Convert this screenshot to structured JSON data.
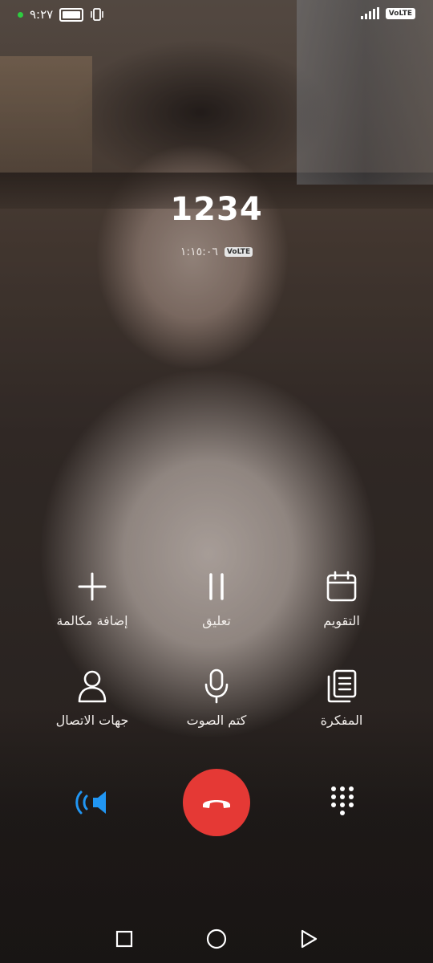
{
  "status_bar": {
    "time": "٩:٢٧",
    "network_badge": "VoLTE",
    "icons": [
      "notification-dot",
      "battery-icon",
      "vibrate-icon",
      "signal-icon",
      "volte-icon"
    ]
  },
  "call": {
    "number": "1234",
    "duration": "١:١٥:٠٦",
    "badge": "VoLTE"
  },
  "actions": {
    "add_call": {
      "label": "إضافة مكالمة",
      "icon": "plus-icon"
    },
    "hold": {
      "label": "تعليق",
      "icon": "pause-icon"
    },
    "calendar": {
      "label": "التقويم",
      "icon": "calendar-icon"
    },
    "contacts": {
      "label": "جهات الاتصال",
      "icon": "person-icon"
    },
    "mute": {
      "label": "كتم الصوت",
      "icon": "microphone-icon"
    },
    "notes": {
      "label": "المفكرة",
      "icon": "notes-icon"
    }
  },
  "controls": {
    "speaker_icon": "speaker-icon",
    "end_call_icon": "hangup-icon",
    "dialpad_icon": "dialpad-icon",
    "colors": {
      "speaker_active": "#2196f3",
      "end_call": "#e53935"
    }
  },
  "nav_bar": [
    "recents-button",
    "home-button",
    "back-button"
  ]
}
